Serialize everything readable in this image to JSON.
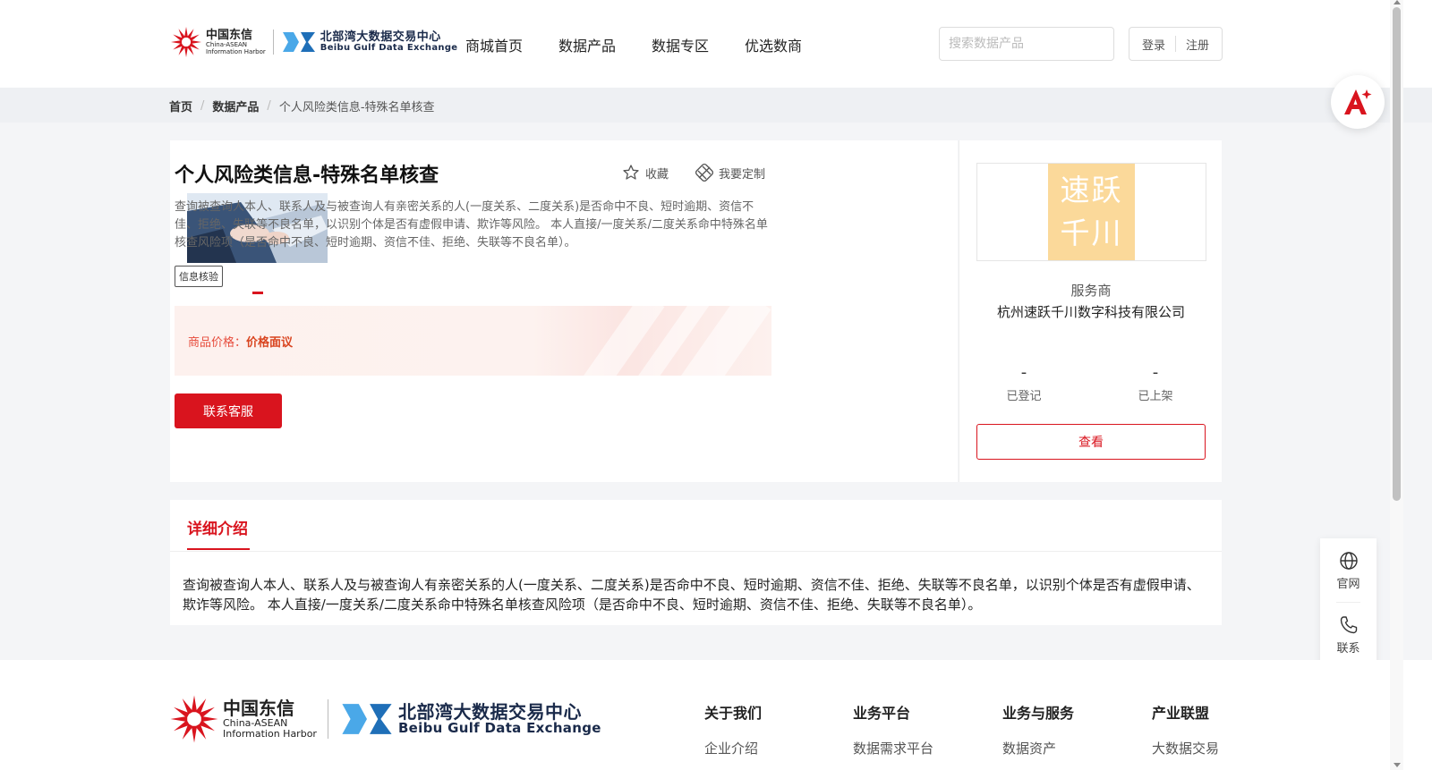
{
  "header": {
    "chinatelecom_cn": "中国东信",
    "chinatelecom_en1": "China-ASEAN",
    "chinatelecom_en2": "Information Harbor",
    "exchange_cn": "北部湾大数据交易中心",
    "exchange_en": "Beibu Gulf Data Exchange",
    "nav": [
      "商城首页",
      "数据产品",
      "数据专区",
      "优选数商"
    ],
    "search_placeholder": "搜索数据产品",
    "login": "登录",
    "register": "注册"
  },
  "breadcrumb": {
    "home": "首页",
    "category": "数据产品",
    "current": "个人风险类信息-特殊名单核查",
    "separator": "/"
  },
  "product": {
    "title": "个人风险类信息-特殊名单核查",
    "favorite_label": "收藏",
    "customize_label": "我要定制",
    "description": "查询被查询人本人、联系人及与被查询人有亲密关系的人(一度关系、二度关系)是否命中不良、短时逾期、资信不佳、拒绝、失联等不良名单，以识别个体是否有虚假申请、欺诈等风险。 本人直接/一度关系/二度关系命中特殊名单核查风险项（是否命中不良、短时逾期、资信不佳、拒绝、失联等不良名单）。",
    "tag": "信息核验",
    "price_label": "商品价格：",
    "price_value": "价格面议",
    "contact_button": "联系客服"
  },
  "provider": {
    "logo_line1": "速跃",
    "logo_line2": "千川",
    "label": "服务商",
    "name": "杭州速跃千川数字科技有限公司",
    "registered_value": "-",
    "registered_label": "已登记",
    "listed_value": "-",
    "listed_label": "已上架",
    "view_button": "查看"
  },
  "detail": {
    "tab": "详细介绍",
    "text": "查询被查询人本人、联系人及与被查询人有亲密关系的人(一度关系、二度关系)是否命中不良、短时逾期、资信不佳、拒绝、失联等不良名单，以识别个体是否有虚假申请、欺诈等风险。 本人直接/一度关系/二度关系命中特殊名单核查风险项（是否命中不良、短时逾期、资信不佳、拒绝、失联等不良名单）。"
  },
  "side_float": {
    "website": "官网",
    "contact": "联系"
  },
  "footer": {
    "columns": [
      {
        "heading": "关于我们",
        "item": "企业介绍"
      },
      {
        "heading": "业务平台",
        "item": "数据需求平台"
      },
      {
        "heading": "业务与服务",
        "item": "数据资产"
      },
      {
        "heading": "产业联盟",
        "item": "大数据交易"
      }
    ]
  },
  "colors": {
    "brand_red": "#d9141e",
    "price_orange": "#e74c3c",
    "provider_logo_bg": "#fbd99a",
    "exchange_blue": "#2a8ad8"
  },
  "icons": [
    "search-icon",
    "star-icon",
    "customize-icon",
    "ai-assistant-icon",
    "globe-icon",
    "phone-icon"
  ]
}
